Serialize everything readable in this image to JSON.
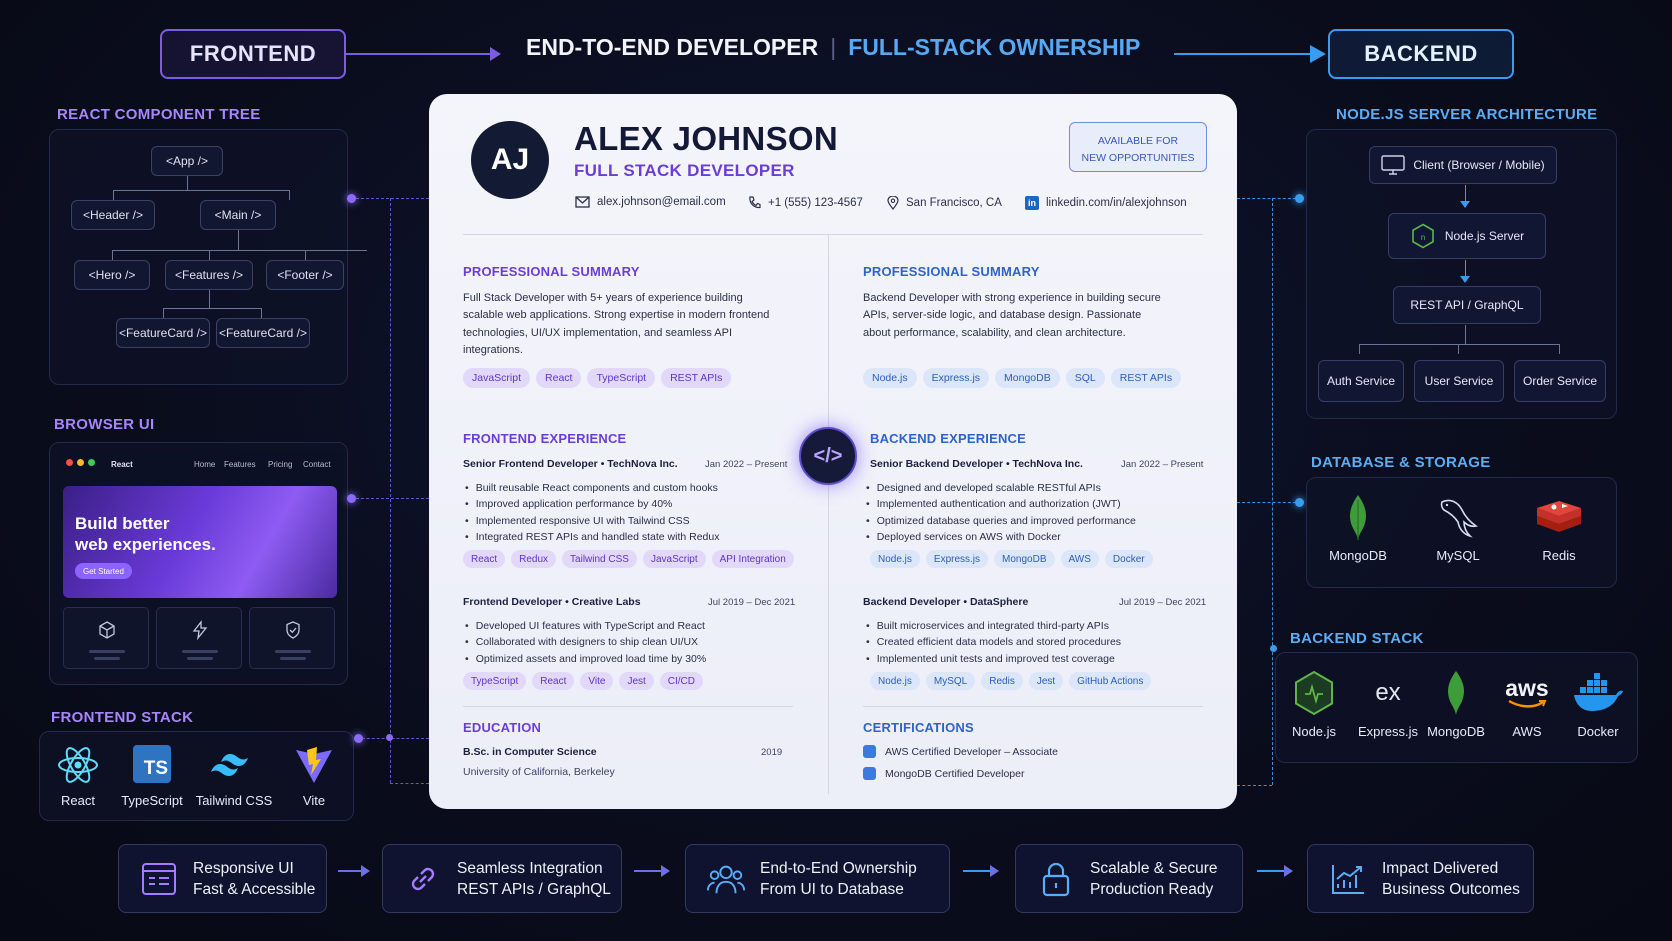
{
  "header": {
    "frontend_label": "FRONTEND",
    "title_main": "END-TO-END DEVELOPER",
    "title_sub": "FULL-STACK OWNERSHIP",
    "backend_label": "BACKEND"
  },
  "left": {
    "tree_title": "REACT COMPONENT TREE",
    "tree_nodes": [
      "<App />",
      "<Header />",
      "<Main />",
      "<Hero />",
      "<Features />",
      "<Footer />",
      "<FeatureCard />",
      "<FeatureCard />"
    ],
    "browser_title": "BROWSER UI",
    "browser": {
      "brand": "React",
      "nav": [
        "Home",
        "Features",
        "Pricing",
        "Contact"
      ],
      "hero_text": "Build better\nweb experiences.",
      "cta": "Get Started"
    },
    "stack_title": "FRONTEND STACK",
    "stack": [
      "React",
      "TypeScript",
      "Tailwind CSS",
      "Vite"
    ]
  },
  "resume": {
    "initials": "AJ",
    "name": "ALEX JOHNSON",
    "role": "FULL STACK DEVELOPER",
    "availability": "AVAILABLE FOR\nNEW OPPORTUNITIES",
    "email": "alex.johnson@email.com",
    "phone": "+1 (555) 123-4567",
    "location": "San Francisco, CA",
    "linkedin": "linkedin.com/in/alexjohnson",
    "center_icon": "</>",
    "fe": {
      "summary_title": "PROFESSIONAL SUMMARY",
      "summary": "Full Stack Developer with 5+ years of experience building scalable web applications. Strong expertise in modern frontend technologies, UI/UX implementation, and seamless API integrations.",
      "summary_tags": [
        "JavaScript",
        "React",
        "TypeScript",
        "REST APIs"
      ],
      "exp_title": "FRONTEND EXPERIENCE",
      "jobs": [
        {
          "title": "Senior Frontend Developer  •  TechNova Inc.",
          "date": "Jan 2022 – Present",
          "bullets": [
            "Built reusable React components and custom hooks",
            "Improved application performance by 40%",
            "Implemented responsive UI with Tailwind CSS",
            "Integrated REST APIs and handled state with Redux"
          ],
          "tags": [
            "React",
            "Redux",
            "Tailwind CSS",
            "JavaScript",
            "API Integration"
          ]
        },
        {
          "title": "Frontend Developer  •  Creative Labs",
          "date": "Jul 2019 – Dec 2021",
          "bullets": [
            "Developed UI features with TypeScript and React",
            "Collaborated with designers to ship clean UI/UX",
            "Optimized assets and improved load time by 30%"
          ],
          "tags": [
            "TypeScript",
            "React",
            "Vite",
            "Jest",
            "CI/CD"
          ]
        }
      ],
      "edu_title": "EDUCATION",
      "degree": "B.Sc. in Computer Science",
      "year": "2019",
      "school": "University of California, Berkeley"
    },
    "be": {
      "summary_title": "PROFESSIONAL SUMMARY",
      "summary": "Backend Developer with strong experience in building secure APIs, server-side logic, and database design. Passionate about performance, scalability, and clean architecture.",
      "summary_tags": [
        "Node.js",
        "Express.js",
        "MongoDB",
        "SQL",
        "REST APIs"
      ],
      "exp_title": "BACKEND EXPERIENCE",
      "jobs": [
        {
          "title": "Senior Backend Developer  •  TechNova Inc.",
          "date": "Jan 2022 – Present",
          "bullets": [
            "Designed and developed scalable RESTful APIs",
            "Implemented authentication and authorization (JWT)",
            "Optimized database queries and improved performance",
            "Deployed services on AWS with Docker"
          ],
          "tags": [
            "Node.js",
            "Express.js",
            "MongoDB",
            "AWS",
            "Docker"
          ]
        },
        {
          "title": "Backend Developer  •  DataSphere",
          "date": "Jul 2019 – Dec 2021",
          "bullets": [
            "Built microservices and integrated third-party APIs",
            "Created efficient data models and stored procedures",
            "Implemented unit tests and improved test coverage"
          ],
          "tags": [
            "Node.js",
            "MySQL",
            "Redis",
            "Jest",
            "GitHub Actions"
          ]
        }
      ],
      "cert_title": "CERTIFICATIONS",
      "certs": [
        "AWS Certified Developer – Associate",
        "MongoDB Certified Developer"
      ]
    }
  },
  "right": {
    "arch_title": "NODE.JS SERVER ARCHITECTURE",
    "client": "Client (Browser / Mobile)",
    "server": "Node.js Server",
    "api": "REST API / GraphQL",
    "services": [
      "Auth Service",
      "User Service",
      "Order Service"
    ],
    "db_title": "DATABASE & STORAGE",
    "dbs": [
      "MongoDB",
      "MySQL",
      "Redis"
    ],
    "stack_title": "BACKEND STACK",
    "stack": [
      "Node.js",
      "Express.js",
      "MongoDB",
      "AWS",
      "Docker"
    ],
    "express_glyph": "ex",
    "aws_glyph": "aws"
  },
  "bottom": [
    {
      "l1": "Responsive UI",
      "l2": "Fast & Accessible"
    },
    {
      "l1": "Seamless Integration",
      "l2": "REST APIs / GraphQL"
    },
    {
      "l1": "End-to-End Ownership",
      "l2": "From UI to Database"
    },
    {
      "l1": "Scalable & Secure",
      "l2": "Production Ready"
    },
    {
      "l1": "Impact Delivered",
      "l2": "Business Outcomes"
    }
  ],
  "colors": {
    "purple": "#a785ff",
    "blue": "#5aaef5",
    "resume_purple": "#6a3ed6",
    "resume_blue": "#2f63c8"
  }
}
